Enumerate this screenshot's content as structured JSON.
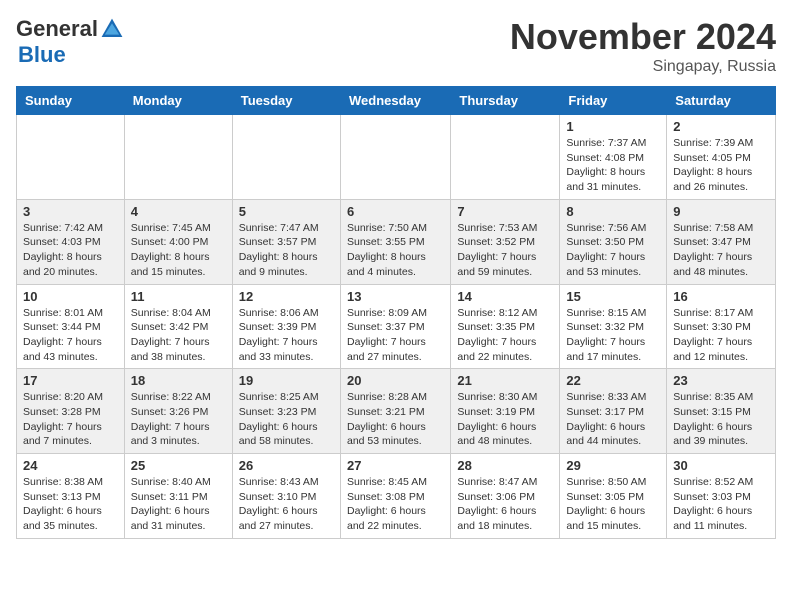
{
  "logo": {
    "general": "General",
    "blue": "Blue"
  },
  "title": "November 2024",
  "location": "Singapay, Russia",
  "days_of_week": [
    "Sunday",
    "Monday",
    "Tuesday",
    "Wednesday",
    "Thursday",
    "Friday",
    "Saturday"
  ],
  "weeks": [
    [
      {
        "day": "",
        "info": ""
      },
      {
        "day": "",
        "info": ""
      },
      {
        "day": "",
        "info": ""
      },
      {
        "day": "",
        "info": ""
      },
      {
        "day": "",
        "info": ""
      },
      {
        "day": "1",
        "info": "Sunrise: 7:37 AM\nSunset: 4:08 PM\nDaylight: 8 hours and 31 minutes."
      },
      {
        "day": "2",
        "info": "Sunrise: 7:39 AM\nSunset: 4:05 PM\nDaylight: 8 hours and 26 minutes."
      }
    ],
    [
      {
        "day": "3",
        "info": "Sunrise: 7:42 AM\nSunset: 4:03 PM\nDaylight: 8 hours and 20 minutes."
      },
      {
        "day": "4",
        "info": "Sunrise: 7:45 AM\nSunset: 4:00 PM\nDaylight: 8 hours and 15 minutes."
      },
      {
        "day": "5",
        "info": "Sunrise: 7:47 AM\nSunset: 3:57 PM\nDaylight: 8 hours and 9 minutes."
      },
      {
        "day": "6",
        "info": "Sunrise: 7:50 AM\nSunset: 3:55 PM\nDaylight: 8 hours and 4 minutes."
      },
      {
        "day": "7",
        "info": "Sunrise: 7:53 AM\nSunset: 3:52 PM\nDaylight: 7 hours and 59 minutes."
      },
      {
        "day": "8",
        "info": "Sunrise: 7:56 AM\nSunset: 3:50 PM\nDaylight: 7 hours and 53 minutes."
      },
      {
        "day": "9",
        "info": "Sunrise: 7:58 AM\nSunset: 3:47 PM\nDaylight: 7 hours and 48 minutes."
      }
    ],
    [
      {
        "day": "10",
        "info": "Sunrise: 8:01 AM\nSunset: 3:44 PM\nDaylight: 7 hours and 43 minutes."
      },
      {
        "day": "11",
        "info": "Sunrise: 8:04 AM\nSunset: 3:42 PM\nDaylight: 7 hours and 38 minutes."
      },
      {
        "day": "12",
        "info": "Sunrise: 8:06 AM\nSunset: 3:39 PM\nDaylight: 7 hours and 33 minutes."
      },
      {
        "day": "13",
        "info": "Sunrise: 8:09 AM\nSunset: 3:37 PM\nDaylight: 7 hours and 27 minutes."
      },
      {
        "day": "14",
        "info": "Sunrise: 8:12 AM\nSunset: 3:35 PM\nDaylight: 7 hours and 22 minutes."
      },
      {
        "day": "15",
        "info": "Sunrise: 8:15 AM\nSunset: 3:32 PM\nDaylight: 7 hours and 17 minutes."
      },
      {
        "day": "16",
        "info": "Sunrise: 8:17 AM\nSunset: 3:30 PM\nDaylight: 7 hours and 12 minutes."
      }
    ],
    [
      {
        "day": "17",
        "info": "Sunrise: 8:20 AM\nSunset: 3:28 PM\nDaylight: 7 hours and 7 minutes."
      },
      {
        "day": "18",
        "info": "Sunrise: 8:22 AM\nSunset: 3:26 PM\nDaylight: 7 hours and 3 minutes."
      },
      {
        "day": "19",
        "info": "Sunrise: 8:25 AM\nSunset: 3:23 PM\nDaylight: 6 hours and 58 minutes."
      },
      {
        "day": "20",
        "info": "Sunrise: 8:28 AM\nSunset: 3:21 PM\nDaylight: 6 hours and 53 minutes."
      },
      {
        "day": "21",
        "info": "Sunrise: 8:30 AM\nSunset: 3:19 PM\nDaylight: 6 hours and 48 minutes."
      },
      {
        "day": "22",
        "info": "Sunrise: 8:33 AM\nSunset: 3:17 PM\nDaylight: 6 hours and 44 minutes."
      },
      {
        "day": "23",
        "info": "Sunrise: 8:35 AM\nSunset: 3:15 PM\nDaylight: 6 hours and 39 minutes."
      }
    ],
    [
      {
        "day": "24",
        "info": "Sunrise: 8:38 AM\nSunset: 3:13 PM\nDaylight: 6 hours and 35 minutes."
      },
      {
        "day": "25",
        "info": "Sunrise: 8:40 AM\nSunset: 3:11 PM\nDaylight: 6 hours and 31 minutes."
      },
      {
        "day": "26",
        "info": "Sunrise: 8:43 AM\nSunset: 3:10 PM\nDaylight: 6 hours and 27 minutes."
      },
      {
        "day": "27",
        "info": "Sunrise: 8:45 AM\nSunset: 3:08 PM\nDaylight: 6 hours and 22 minutes."
      },
      {
        "day": "28",
        "info": "Sunrise: 8:47 AM\nSunset: 3:06 PM\nDaylight: 6 hours and 18 minutes."
      },
      {
        "day": "29",
        "info": "Sunrise: 8:50 AM\nSunset: 3:05 PM\nDaylight: 6 hours and 15 minutes."
      },
      {
        "day": "30",
        "info": "Sunrise: 8:52 AM\nSunset: 3:03 PM\nDaylight: 6 hours and 11 minutes."
      }
    ]
  ]
}
